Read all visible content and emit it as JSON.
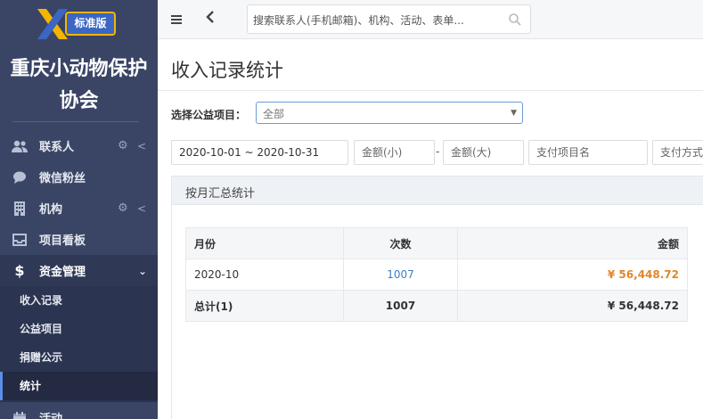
{
  "app": {
    "logo_badge": "标准版",
    "org_name_line1": "重庆小动物保护",
    "org_name_line2": "协会"
  },
  "sidebar": {
    "items": [
      {
        "label": "联系人",
        "icon": "contacts-icon",
        "has_gear": true,
        "has_chevron": true
      },
      {
        "label": "微信粉丝",
        "icon": "wechat-icon",
        "has_gear": false,
        "has_chevron": false
      },
      {
        "label": "机构",
        "icon": "building-icon",
        "has_gear": true,
        "has_chevron": true
      },
      {
        "label": "项目看板",
        "icon": "inbox-icon",
        "has_gear": false,
        "has_chevron": false
      },
      {
        "label": "资金管理",
        "icon": "dollar-icon",
        "has_gear": false,
        "has_chevron": true,
        "expanded": true
      },
      {
        "label": "活动",
        "icon": "calendar-icon",
        "has_gear": false,
        "has_chevron": false
      }
    ],
    "submenu": [
      {
        "label": "收入记录"
      },
      {
        "label": "公益项目"
      },
      {
        "label": "捐赠公示"
      },
      {
        "label": "统计",
        "current": true
      }
    ]
  },
  "topbar": {
    "search_placeholder": "搜索联系人(手机邮箱)、机构、活动、表单..."
  },
  "main": {
    "page_title": "收入记录统计",
    "filter_label": "选择公益项目：",
    "filter_value": "全部",
    "date_range": "2020-10-01 ~ 2020-10-31",
    "amount_min_placeholder": "金额(小)",
    "dash": "-",
    "amount_max_placeholder": "金额(大)",
    "pay_item_placeholder": "支付项目名",
    "pay_method_placeholder": "支付方式",
    "panel_title": "按月汇总统计",
    "table": {
      "headers": [
        "月份",
        "次数",
        "金额"
      ],
      "rows": [
        {
          "month": "2020-10",
          "count": "1007",
          "amount": "¥ 56,448.72"
        }
      ],
      "total": {
        "label": "总计(1)",
        "count": "1007",
        "amount": "¥ 56,448.72"
      }
    }
  },
  "colors": {
    "sidebar_bg": "#3a4566",
    "accent_amount": "#e0862a",
    "link": "#3f7fbf",
    "logo_badge_border": "#f5b400"
  }
}
